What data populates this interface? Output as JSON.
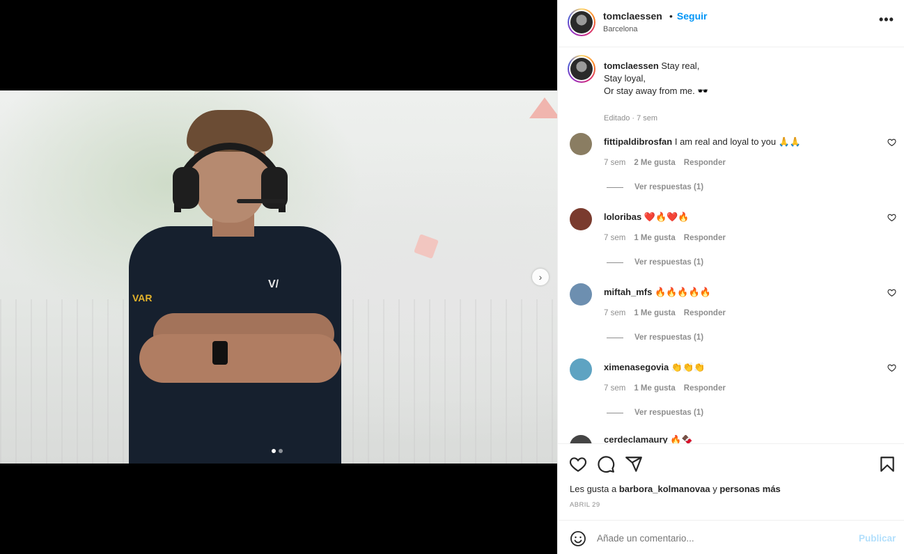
{
  "post": {
    "author": "tomclaessen",
    "bullet": "•",
    "follow_label": "Seguir",
    "location": "Barcelona",
    "more_label": "•••"
  },
  "media": {
    "next_arrow_label": "›",
    "slide_count": 2,
    "active_slide": 1
  },
  "caption": {
    "author": "tomclaessen",
    "line1": "Stay real,",
    "line2": "Stay loyal,",
    "line3": "Or stay away from me. 🕶️",
    "meta": "Editado · 7 sem"
  },
  "comments": [
    {
      "user": "fittipaldibrosfan",
      "text": "I am real and loyal to you 🙏🙏",
      "age": "7 sem",
      "likes": "2 Me gusta",
      "reply": "Responder",
      "replies": "Ver respuestas (1)",
      "avatar_color": "#8a7d62"
    },
    {
      "user": "loloribas",
      "text": "❤️🔥❤️🔥",
      "age": "7 sem",
      "likes": "1 Me gusta",
      "reply": "Responder",
      "replies": "Ver respuestas (1)",
      "avatar_color": "#7a3b2e"
    },
    {
      "user": "miftah_mfs",
      "text": "🔥🔥🔥🔥🔥",
      "age": "7 sem",
      "likes": "1 Me gusta",
      "reply": "Responder",
      "replies": "Ver respuestas (1)",
      "avatar_color": "#6d8fb0"
    },
    {
      "user": "ximenasegovia",
      "text": "👏👏👏",
      "age": "7 sem",
      "likes": "1 Me gusta",
      "reply": "Responder",
      "replies": "Ver respuestas (1)",
      "avatar_color": "#5ea3c2"
    }
  ],
  "partial_comment": {
    "user": "cerdeclamaury",
    "text": "🔥🍫"
  },
  "footer": {
    "likes_prefix": "Les gusta a ",
    "likes_user": "barbora_kolmanovaa",
    "likes_mid": " y ",
    "likes_rest": "personas más",
    "date": "ABRIL 29"
  },
  "comment_box": {
    "placeholder": "Añade un comentario...",
    "publish_label": "Publicar"
  },
  "icons": [
    "heart-icon",
    "comment-icon",
    "share-icon",
    "bookmark-icon",
    "emoji-icon",
    "more-icon",
    "chevron-right-icon"
  ]
}
